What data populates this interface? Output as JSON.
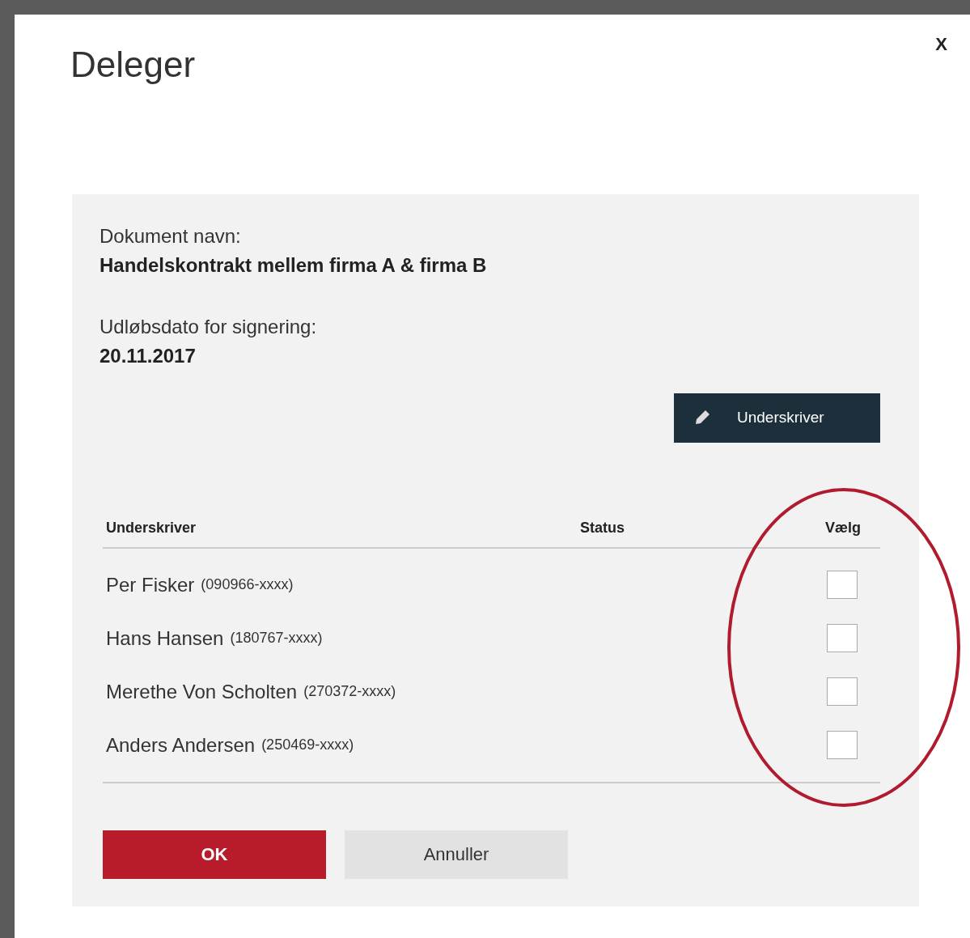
{
  "dialog": {
    "title": "Deleger",
    "close": "X"
  },
  "document": {
    "name_label": "Dokument navn:",
    "name": "Handelskontrakt mellem firma A & firma B",
    "expiry_label": "Udløbsdato for signering:",
    "expiry": "20.11.2017"
  },
  "add_button": {
    "label": "Underskriver"
  },
  "table": {
    "columns": [
      "Underskriver",
      "Status",
      "Vælg"
    ],
    "rows": [
      {
        "name": "Per Fisker",
        "id": "(090966-xxxx)",
        "checked": false
      },
      {
        "name": "Hans Hansen",
        "id": "(180767-xxxx)",
        "checked": false
      },
      {
        "name": "Merethe Von Scholten",
        "id": "(270372-xxxx)",
        "checked": false
      },
      {
        "name": "Anders Andersen",
        "id": "(250469-xxxx)",
        "checked": false
      }
    ]
  },
  "buttons": [
    {
      "label": "OK",
      "kind": "primary"
    },
    {
      "label": "Annuller",
      "kind": "secondary"
    }
  ]
}
